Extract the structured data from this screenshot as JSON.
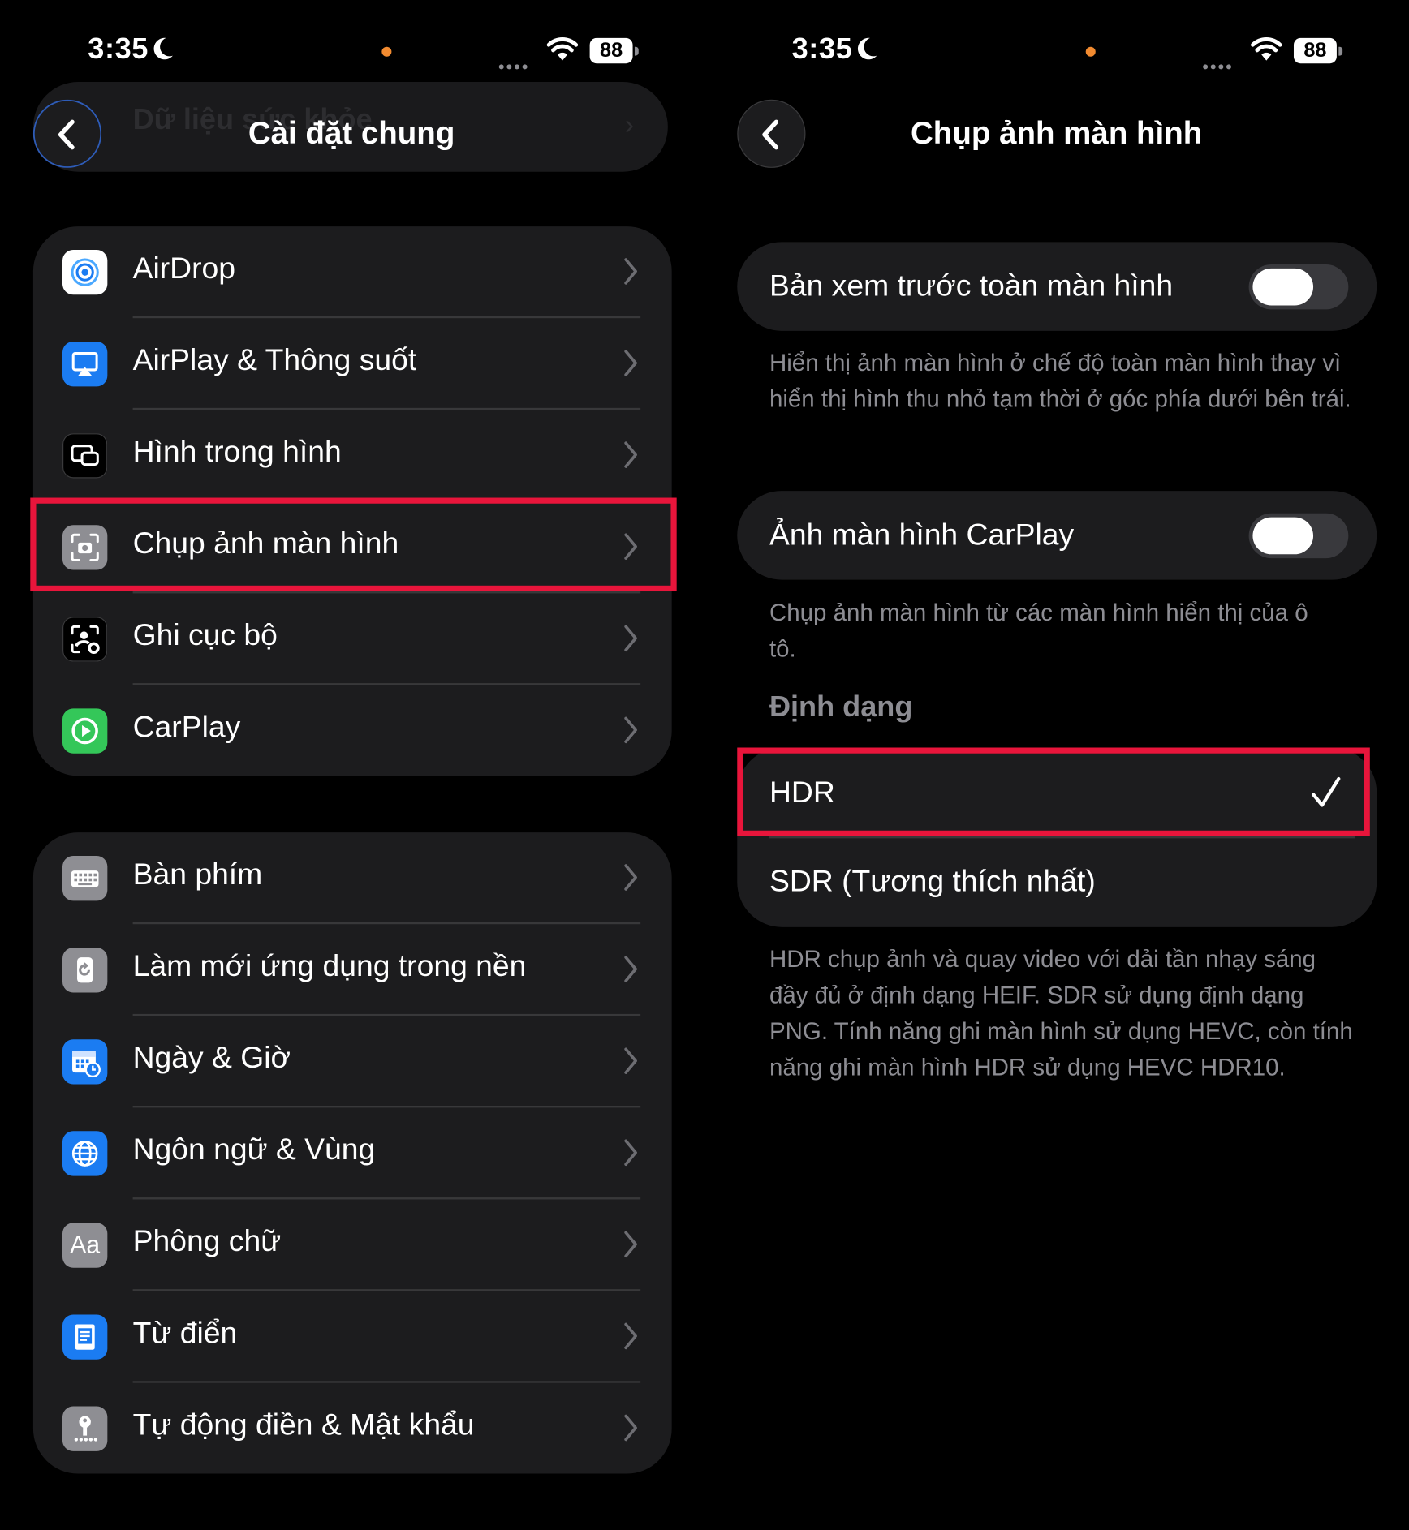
{
  "left_panel": {
    "status": {
      "time": "3:35",
      "battery": "88"
    },
    "nav": {
      "back_hint": "Dữ liệu sức khỏe",
      "title": "Cài đặt chung"
    },
    "group1": [
      {
        "label": "AirDrop",
        "icon": "airdrop-icon",
        "color": "#ffffff"
      },
      {
        "label": "AirPlay & Thông suốt",
        "icon": "airplay-icon",
        "color": "#1b7cf2"
      },
      {
        "label": "Hình trong hình",
        "icon": "picture-in-picture-icon",
        "color": "#1c1c1e"
      },
      {
        "label": "Chụp ảnh màn hình",
        "icon": "screenshot-icon",
        "color": "#8e8e93"
      },
      {
        "label": "Ghi cục bộ",
        "icon": "local-capture-icon",
        "color": "#000000"
      },
      {
        "label": "CarPlay",
        "icon": "carplay-icon",
        "color": "#34c759"
      }
    ],
    "group2": [
      {
        "label": "Bàn phím",
        "icon": "keyboard-icon",
        "color": "#8e8e93"
      },
      {
        "label": "Làm mới ứng dụng trong nền",
        "icon": "background-refresh-icon",
        "color": "#8e8e93"
      },
      {
        "label": "Ngày & Giờ",
        "icon": "calendar-clock-icon",
        "color": "#1b7cf2"
      },
      {
        "label": "Ngôn ngữ & Vùng",
        "icon": "globe-icon",
        "color": "#1b7cf2"
      },
      {
        "label": "Phông chữ",
        "icon": "font-icon",
        "color": "#8e8e93"
      },
      {
        "label": "Từ điển",
        "icon": "dictionary-icon",
        "color": "#1b7cf2"
      },
      {
        "label": "Tự động điền & Mật khẩu",
        "icon": "key-icon",
        "color": "#8e8e93"
      }
    ]
  },
  "right_panel": {
    "status": {
      "time": "3:35",
      "battery": "88"
    },
    "nav": {
      "title": "Chụp ảnh màn hình"
    },
    "fullscreen_preview": {
      "label": "Bản xem trước toàn màn hình",
      "enabled": true,
      "footnote": "Hiển thị ảnh màn hình ở chế độ toàn màn hình thay vì hiển thị hình thu nhỏ tạm thời ở góc phía dưới bên trái."
    },
    "carplay_screenshot": {
      "label": "Ảnh màn hình CarPlay",
      "enabled": true,
      "footnote": "Chụp ảnh màn hình từ các màn hình hiển thị của ô tô."
    },
    "format": {
      "header": "Định dạng",
      "options": [
        {
          "label": "HDR",
          "selected": true
        },
        {
          "label": "SDR (Tương thích nhất)",
          "selected": false
        }
      ],
      "footnote": "HDR chụp ảnh và quay video với dải tần nhạy sáng đầy đủ ở định dạng HEIF. SDR sử dụng định dạng PNG. Tính năng ghi màn hình sử dụng HEVC, còn tính năng ghi màn hình HDR sử dụng HEVC HDR10."
    }
  },
  "colors": {
    "highlight": "#e8153b",
    "cell_bg": "#1c1c1e",
    "secondary_text": "#8d8d93"
  }
}
